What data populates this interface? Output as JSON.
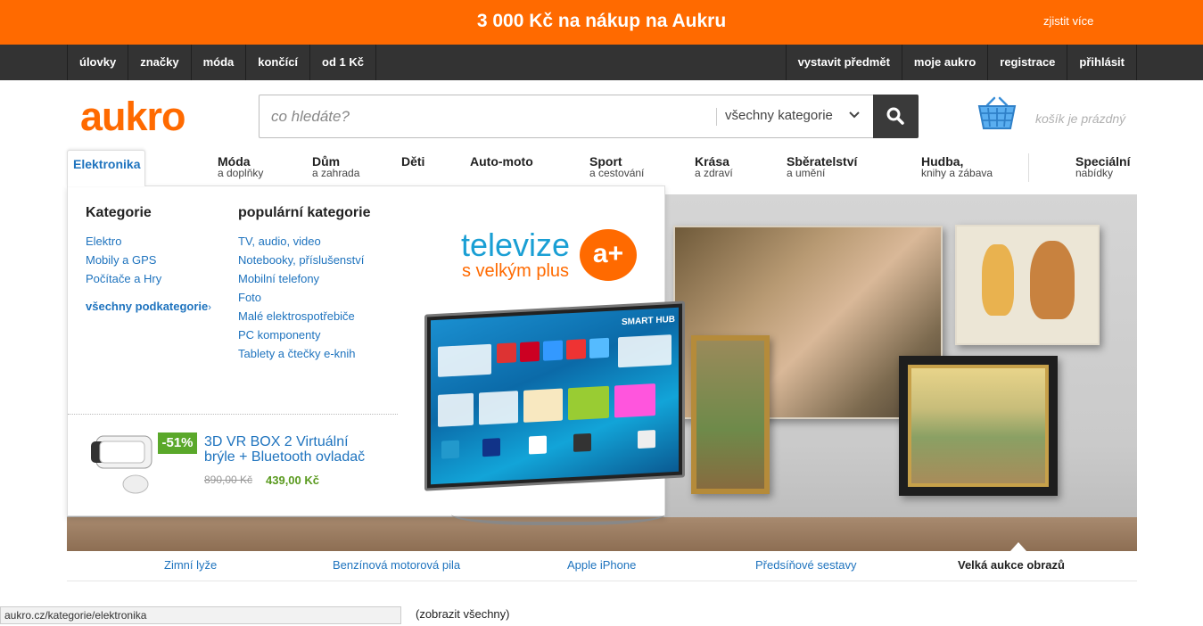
{
  "promo": {
    "text": "3 000 Kč na nákup na Aukru",
    "link": "zjistit více",
    "color": "#ff6a00"
  },
  "topnav": {
    "left": [
      "úlovky",
      "značky",
      "móda",
      "končící",
      "od 1 Kč"
    ],
    "right": [
      "vystavit předmět",
      "moje aukro",
      "registrace",
      "přihlásit"
    ]
  },
  "header": {
    "logo": "aukro",
    "search_placeholder": "co hledáte?",
    "search_category": "všechny kategorie",
    "cart": "košík je prázdný"
  },
  "categories": [
    {
      "label": "Elektronika",
      "sub": ""
    },
    {
      "label": "Móda",
      "sub": "a doplňky"
    },
    {
      "label": "Dům",
      "sub": "a zahrada"
    },
    {
      "label": "Děti",
      "sub": ""
    },
    {
      "label": "Auto-moto",
      "sub": ""
    },
    {
      "label": "Sport",
      "sub": "a cestování"
    },
    {
      "label": "Krása",
      "sub": "a zdraví"
    },
    {
      "label": "Sběratelství",
      "sub": "a umění"
    },
    {
      "label": "Hudba,",
      "sub": "knihy a zábava"
    },
    {
      "label": "Speciální",
      "sub": "nabídky"
    }
  ],
  "dropdown": {
    "kategorie_title": "Kategorie",
    "kategorie": [
      "Elektro",
      "Mobily a GPS",
      "Počítače a Hry"
    ],
    "all_sub": "všechny podkategorie",
    "popular_title": "populární kategorie",
    "popular": [
      "TV, audio, video",
      "Notebooky, příslušenství",
      "Mobilní telefony",
      "Foto",
      "Malé elektrospotřebiče",
      "PC komponenty",
      "Tablety a čtečky e-knih"
    ],
    "promo_brand": "televize",
    "promo_sub": "s velkým plus",
    "promo_badge": "a+",
    "tv_label": "SMART HUB",
    "product": {
      "discount": "-51%",
      "title": "3D VR BOX 2 Virtuální brýle + Bluetooth ovladač",
      "old_price": "890,00 Kč",
      "new_price": "439,00 Kč"
    }
  },
  "carousel": [
    "Zimní lyže",
    "Benzínová motorová pila",
    "Apple iPhone",
    "Předsíňové sestavy",
    "Velká aukce obrazů"
  ],
  "bottom": {
    "show_all": "(zobrazit všechny)"
  },
  "statusbar": "aukro.cz/kategorie/elektronika"
}
